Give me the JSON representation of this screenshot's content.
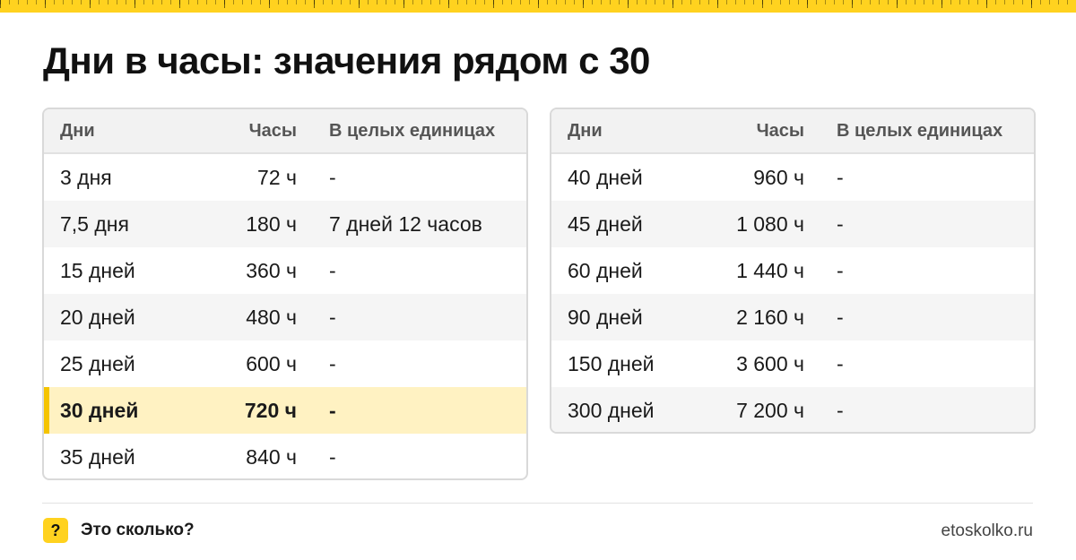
{
  "title": "Дни в часы: значения рядом с 30",
  "colors": {
    "accent": "#ffd21f",
    "highlight_bg": "#fff2c2",
    "highlight_bar": "#f5c400"
  },
  "columns": [
    "Дни",
    "Часы",
    "В целых единицах"
  ],
  "left_table": [
    {
      "days": "3 дня",
      "hours": "72 ч",
      "whole": "-"
    },
    {
      "days": "7,5 дня",
      "hours": "180 ч",
      "whole": "7 дней 12 часов"
    },
    {
      "days": "15 дней",
      "hours": "360 ч",
      "whole": "-"
    },
    {
      "days": "20 дней",
      "hours": "480 ч",
      "whole": "-"
    },
    {
      "days": "25 дней",
      "hours": "600 ч",
      "whole": "-"
    },
    {
      "days": "30 дней",
      "hours": "720 ч",
      "whole": "-",
      "highlighted": true
    },
    {
      "days": "35 дней",
      "hours": "840 ч",
      "whole": "-"
    }
  ],
  "right_table": [
    {
      "days": "40 дней",
      "hours": "960 ч",
      "whole": "-"
    },
    {
      "days": "45 дней",
      "hours": "1 080 ч",
      "whole": "-"
    },
    {
      "days": "60 дней",
      "hours": "1 440 ч",
      "whole": "-"
    },
    {
      "days": "90 дней",
      "hours": "2 160 ч",
      "whole": "-"
    },
    {
      "days": "150 дней",
      "hours": "3 600 ч",
      "whole": "-"
    },
    {
      "days": "300 дней",
      "hours": "7 200 ч",
      "whole": "-"
    }
  ],
  "footer": {
    "badge_icon": "?",
    "brand": "Это сколько?",
    "site": "etoskolko.ru"
  }
}
